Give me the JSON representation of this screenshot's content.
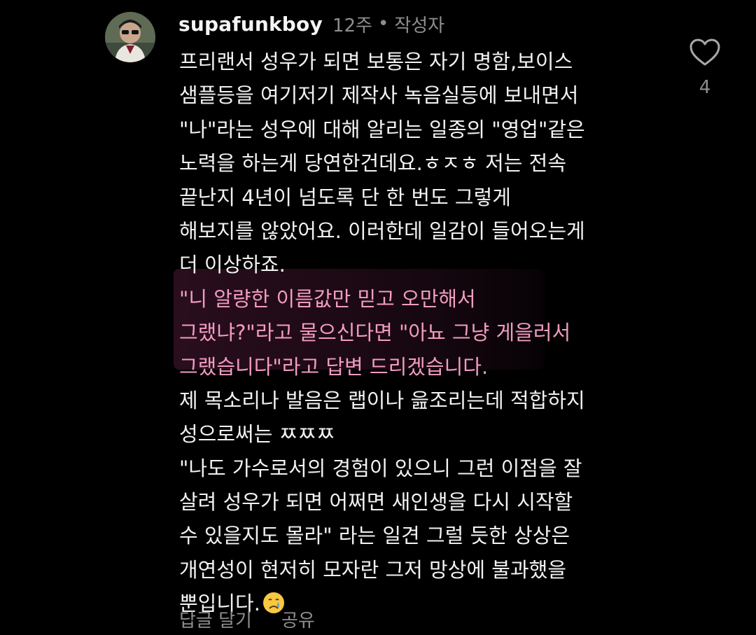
{
  "comment": {
    "username": "supafunkboy",
    "time": "12주",
    "separator": "•",
    "author_badge": "작성자",
    "lines": [
      "프리랜서 성우가 되면 보통은 자기 명함,보이스",
      "샘플등을 여기저기 제작사 녹음실등에 보내면서",
      "\"나\"라는 성우에 대해 알리는 일종의 \"영업\"같은",
      "노력을 하는게 당연한건데요.ㅎㅈㅎ 저는 전속",
      "끝난지 4년이 넘도록 단 한 번도 그렇게",
      "해보지를 않았어요. 이러한데 일감이 들어오는게",
      "더 이상하죠.",
      "\"니 알량한 이름값만 믿고 오만해서",
      "그랬냐?\"라고 물으신다면 \"아뇨 그냥 게을러서",
      "그랬습니다\"라고 답변 드리겠습니다.",
      "제 목소리나 발음은 랩이나 읊조리는데 적합하지",
      "성으로써는 ㅉㅉㅉ",
      "\"나도 가수로서의 경험이 있으니 그런 이점을 잘",
      "살려 성우가 되면 어쩌면 새인생을 다시 시작할",
      "수 있을지도 몰라\" 라는 일견 그럴 듯한 상상은",
      "개연성이 현저히 모자란 그저 망상에 불과했을",
      "뿐입니다."
    ],
    "last_line_emoji": "crying-face-emoji",
    "like_count": "4",
    "actions": {
      "reply": "답글 달기",
      "share": "공유"
    }
  },
  "colors": {
    "background": "#000000",
    "text": "#f2f2f2",
    "muted": "#8e8e8e",
    "highlight_text": "#f29cc0"
  }
}
